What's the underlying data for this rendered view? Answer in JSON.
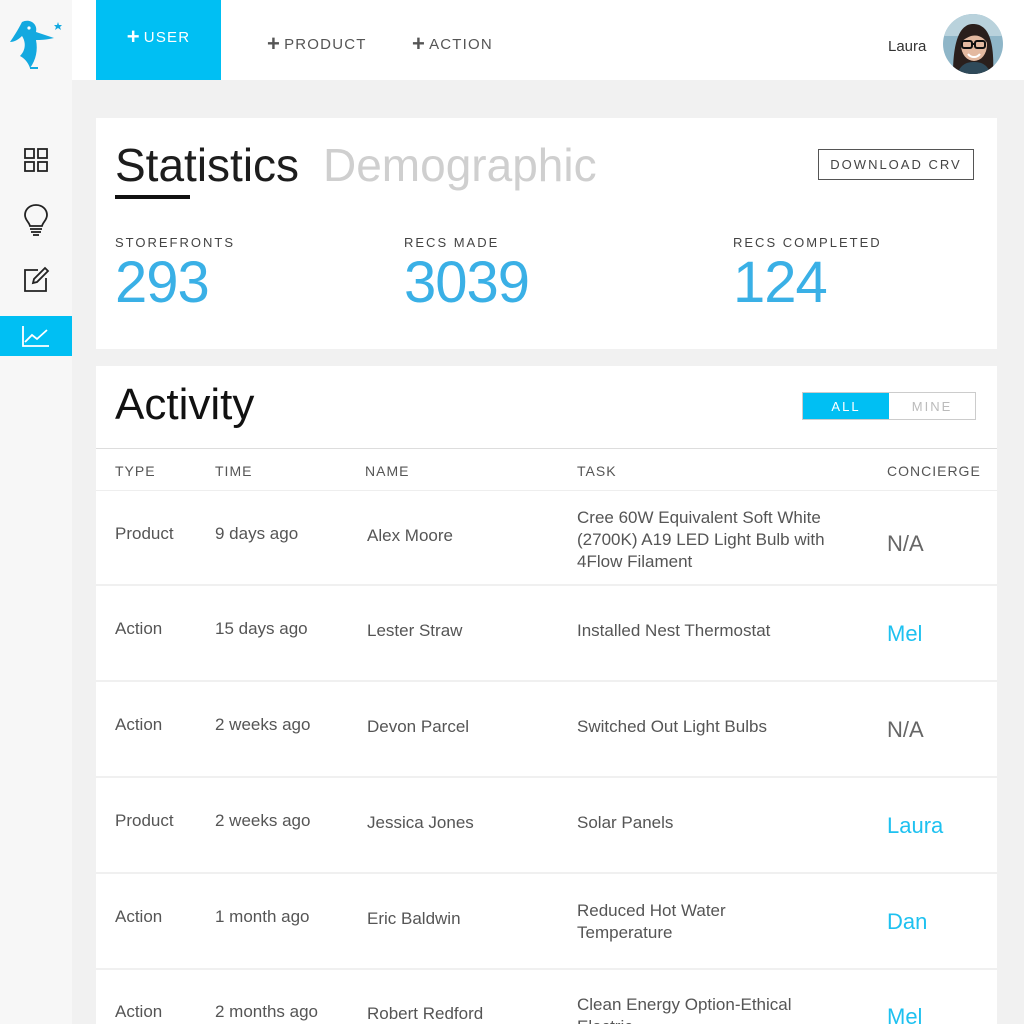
{
  "nav": {
    "user": "USER",
    "product": "PRODUCT",
    "action": "ACTION",
    "plus": "+"
  },
  "header": {
    "user_name": "Laura"
  },
  "colors": {
    "accent": "#00bff3",
    "stat_value": "#3ab0e6",
    "concierge_link": "#1ec1f0"
  },
  "icons": [
    "penguin-logo-icon",
    "grid-icon",
    "lightbulb-icon",
    "edit-icon",
    "chart-icon"
  ],
  "stats": {
    "tab_active": "Statistics",
    "tab_inactive": "Demographic",
    "download_label": "DOWNLOAD CRV",
    "items": [
      {
        "label": "STOREFRONTS",
        "value": "293"
      },
      {
        "label": "RECS MADE",
        "value": "3039"
      },
      {
        "label": "RECS COMPLETED",
        "value": "124"
      }
    ]
  },
  "activity": {
    "title": "Activity",
    "filter_all": "ALL",
    "filter_mine": "MINE",
    "columns": [
      "TYPE",
      "TIME",
      "NAME",
      "TASK",
      "CONCIERGE"
    ],
    "rows": [
      {
        "type": "Product",
        "time": "9 days ago",
        "name": "Alex Moore",
        "task": "Cree 60W Equivalent Soft White (2700K) A19 LED Light Bulb with 4Flow Filament",
        "concierge": "N/A"
      },
      {
        "type": "Action",
        "time": "15 days ago",
        "name": "Lester Straw",
        "task": "Installed Nest Thermostat",
        "concierge": "Mel"
      },
      {
        "type": "Action",
        "time": "2 weeks ago",
        "name": "Devon Parcel",
        "task": "Switched Out Light Bulbs",
        "concierge": "N/A"
      },
      {
        "type": "Product",
        "time": "2 weeks ago",
        "name": "Jessica Jones",
        "task": "Solar Panels",
        "concierge": "Laura"
      },
      {
        "type": "Action",
        "time": "1 month ago",
        "name": "Eric Baldwin",
        "task": "Reduced Hot Water Temperature",
        "concierge": "Dan"
      },
      {
        "type": "Action",
        "time": "2 months ago",
        "name": "Robert Redford",
        "task": "Clean Energy Option-Ethical Electric",
        "concierge": "Mel"
      }
    ]
  }
}
